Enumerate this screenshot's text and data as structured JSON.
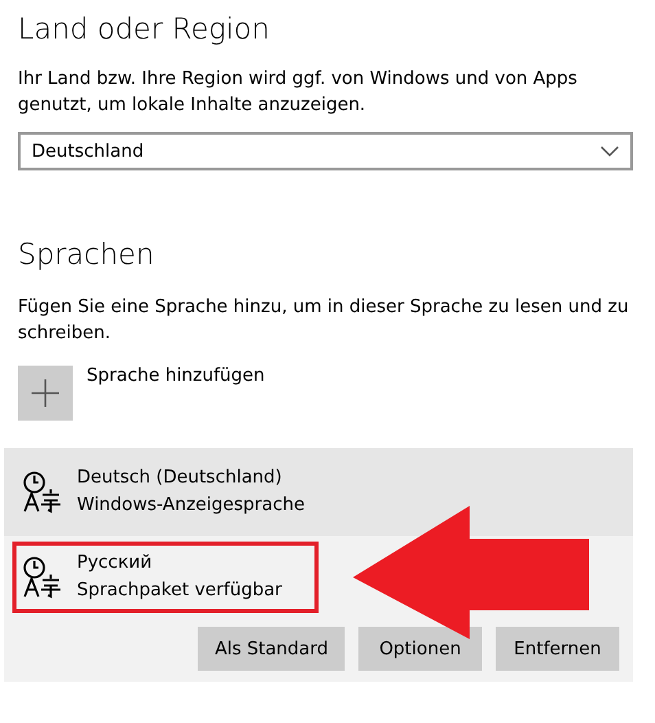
{
  "region": {
    "heading": "Land oder Region",
    "description": "Ihr Land bzw. Ihre Region wird ggf. von Windows und von Apps genutzt, um lokale Inhalte anzuzeigen.",
    "dropdown": {
      "value": "Deutschland"
    }
  },
  "languages": {
    "heading": "Sprachen",
    "description": "Fügen Sie eine Sprache hinzu, um in dieser Sprache zu lesen und zu schreiben.",
    "add_button": {
      "label": "Sprache hinzufügen"
    },
    "items": [
      {
        "name": "Deutsch (Deutschland)",
        "status": "Windows-Anzeigesprache",
        "selected": false,
        "hovered": true,
        "highlighted": false
      },
      {
        "name": "Русский",
        "status": "Sprachpaket verfügbar",
        "selected": true,
        "hovered": false,
        "highlighted": true
      }
    ],
    "actions": [
      "Als Standard",
      "Optionen",
      "Entfernen"
    ]
  }
}
